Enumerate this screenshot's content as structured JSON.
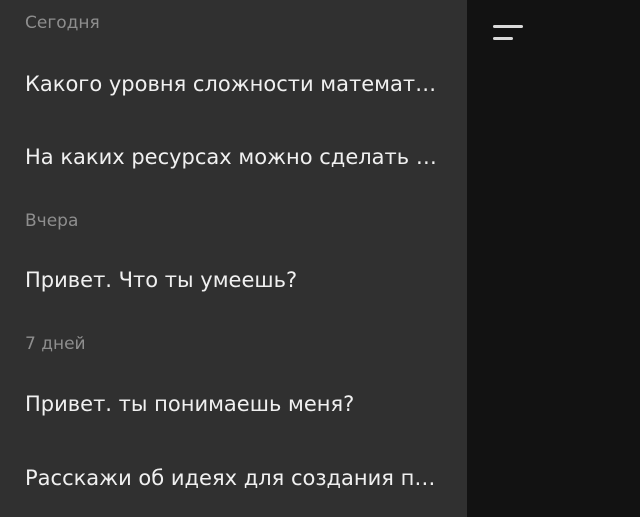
{
  "drawer": {
    "sections": [
      {
        "header": "Сегодня",
        "items": [
          "Какого уровня сложности математических задач ты можешь решать?",
          "На каких ресурсах можно сделать сайт бесплатно?"
        ]
      },
      {
        "header": "Вчера",
        "items": [
          "Привет. Что ты умеешь?"
        ]
      },
      {
        "header": "7 дней",
        "items": [
          "Привет. ты понимаешь меня?",
          "Расскажи об идеях для создания приложения"
        ]
      }
    ]
  },
  "icons": {
    "menu": "menu-icon"
  },
  "colors": {
    "drawer_background": "#303030",
    "main_background": "#121212",
    "section_header_text": "#8e8e8e",
    "item_text": "#f0f0f0",
    "icon": "#d9d9d9"
  }
}
